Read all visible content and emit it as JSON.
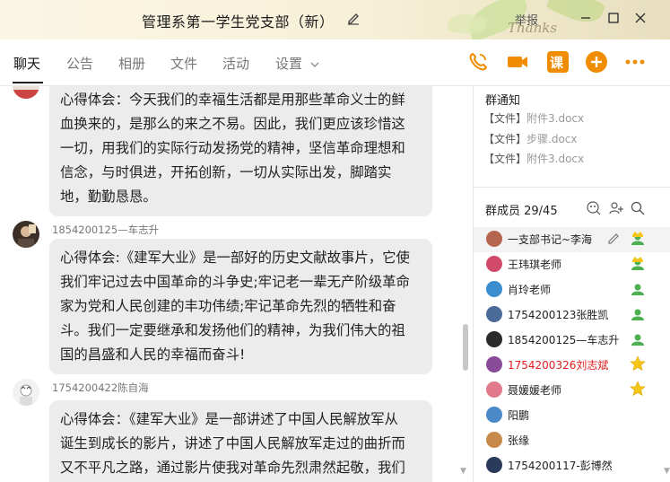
{
  "window": {
    "title": "管理系第一学生党支部（新）",
    "report_label": "举报",
    "decor_text": "Thanks"
  },
  "tabs": [
    {
      "label": "聊天",
      "active": true
    },
    {
      "label": "公告"
    },
    {
      "label": "相册"
    },
    {
      "label": "文件"
    },
    {
      "label": "活动"
    },
    {
      "label": "设置"
    }
  ],
  "toolbar": {
    "icons": [
      "phone-icon",
      "video-icon",
      "class-icon",
      "add-icon",
      "more-icon"
    ],
    "class_label": "课",
    "accent": "#f08c00"
  },
  "chat": {
    "messages": [
      {
        "sender": "",
        "lines": [
          "心得体会：今天我们的幸福生活都是用那些革命义士的鲜",
          "血换来的，是那么的来之不易。因此，我们更应该珍惜这",
          "一切，用我们的实际行动发扬党的精神，坚信革命理想和",
          "信念，与时俱进，开拓创新，一切从实际出发，脚踏实",
          "地，勤勤恳恳。"
        ]
      },
      {
        "sender": "1854200125—车志升",
        "lines": [
          "心得体会:《建军大业》是一部好的历史文献故事片，它使",
          "我们牢记过去中国革命的斗争史;牢记老一辈无产阶级革命",
          "家为党和人民创建的丰功伟绩;牢记革命先烈的牺牲和奋",
          "斗。我们一定要继承和发扬他们的精神，为我们伟大的祖",
          "国的昌盛和人民的幸福而奋斗!"
        ]
      },
      {
        "sender": "1754200422陈自海",
        "lines": [
          "心得体会：《建军大业》是一部讲述了中国人民解放军从",
          "诞生到成长的影片，讲述了中国人民解放军走过的曲折而",
          "又不平凡之路，通过影片使我对革命先烈肃然起敬，我们"
        ]
      }
    ]
  },
  "side": {
    "notice_title": "群通知",
    "files": [
      {
        "tag": "【文件】",
        "name": "附件3.docx"
      },
      {
        "tag": "【文件】",
        "name": "步骤.docx"
      },
      {
        "tag": "【文件】",
        "name": "附件3.docx"
      }
    ],
    "members_title": "群成员 29/45",
    "members": [
      {
        "name": "一支部书记~李海",
        "badge": "owner-icon"
      },
      {
        "name": "王玮琪老师",
        "badge": "admin-icon"
      },
      {
        "name": "肖玲老师",
        "badge": "member-icon"
      },
      {
        "name": "1754200123张胜凯",
        "badge": "member-icon"
      },
      {
        "name": "1854200125—车志升",
        "badge": "member-icon"
      },
      {
        "name": "1754200326刘志斌",
        "badge": "star-icon",
        "highlight": true
      },
      {
        "name": "聂媛媛老师",
        "badge": "star-icon"
      },
      {
        "name": "阳鹏",
        "badge": ""
      },
      {
        "name": "张缘",
        "badge": ""
      },
      {
        "name": "1754200117-彭博然",
        "badge": ""
      }
    ]
  }
}
